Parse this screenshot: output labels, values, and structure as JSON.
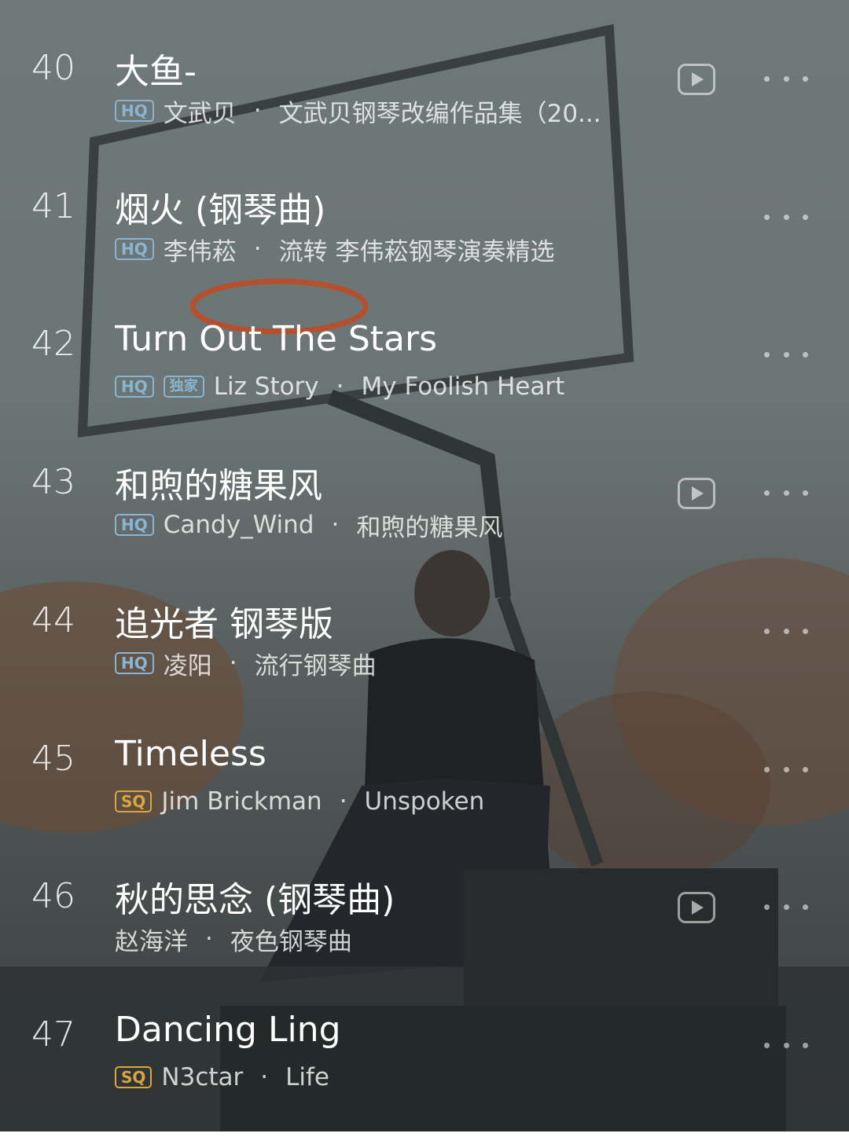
{
  "songs": [
    {
      "index": "40",
      "title": "大鱼-",
      "badges": [
        {
          "text": "HQ",
          "kind": "hq"
        }
      ],
      "artist": "文武贝",
      "album": "文武贝钢琴改编作品集（20...",
      "video": true
    },
    {
      "index": "41",
      "title": "烟火 (钢琴曲)",
      "badges": [
        {
          "text": "HQ",
          "kind": "hq"
        }
      ],
      "artist": "李伟菘",
      "album": "流转 李伟菘钢琴演奏精选",
      "video": false
    },
    {
      "index": "42",
      "title": "Turn Out The Stars",
      "badges": [
        {
          "text": "HQ",
          "kind": "hq"
        },
        {
          "text": "独家",
          "kind": "excl"
        }
      ],
      "artist": "Liz Story",
      "album": "My Foolish Heart",
      "video": false
    },
    {
      "index": "43",
      "title": "和煦的糖果风",
      "badges": [
        {
          "text": "HQ",
          "kind": "hq"
        }
      ],
      "artist": "Candy_Wind",
      "album": "和煦的糖果风",
      "video": true
    },
    {
      "index": "44",
      "title": "追光者 钢琴版",
      "badges": [
        {
          "text": "HQ",
          "kind": "hq"
        }
      ],
      "artist": "凌阳",
      "album": "流行钢琴曲",
      "video": false
    },
    {
      "index": "45",
      "title": "Timeless",
      "badges": [
        {
          "text": "SQ",
          "kind": "sq"
        }
      ],
      "artist": "Jim Brickman",
      "album": "Unspoken",
      "video": false
    },
    {
      "index": "46",
      "title": "秋的思念 (钢琴曲)",
      "badges": [],
      "artist": "赵海洋",
      "album": "夜色钢琴曲",
      "video": true
    },
    {
      "index": "47",
      "title": "Dancing Ling",
      "badges": [
        {
          "text": "SQ",
          "kind": "sq"
        }
      ],
      "artist": "N3ctar",
      "album": "Life",
      "video": false
    }
  ],
  "separator": "·",
  "icons": {
    "video": "play-video-icon",
    "more": "more-options-icon"
  },
  "colors": {
    "hq": "#8ab4cf",
    "sq": "#d9a640"
  }
}
